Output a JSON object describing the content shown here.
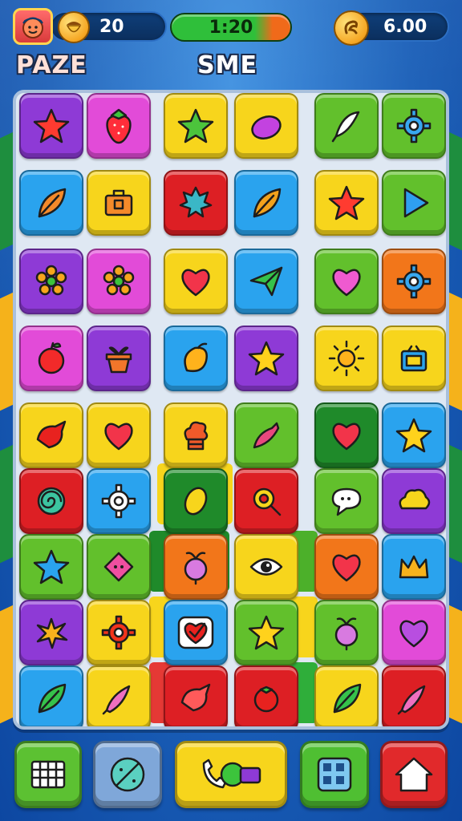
{
  "hud": {
    "moves": "20",
    "timer": "1:20",
    "score": "6.00"
  },
  "titles": {
    "left": "PAZE",
    "right": "SME"
  },
  "colors": {
    "purple": "#8e3ad6",
    "magenta": "#e24bd8",
    "yellow": "#f7d51c",
    "green": "#62c02c",
    "blue": "#2aa3ee",
    "red": "#dd1f24",
    "orange": "#f2761a",
    "dark_green": "#1f8a2a"
  },
  "board": {
    "rows": [
      [
        [
          "purple",
          "star"
        ],
        [
          "magenta",
          "strawberry"
        ],
        [
          "yellow",
          "star"
        ],
        [
          "yellow",
          "eggplant"
        ],
        [
          "green",
          "feather"
        ],
        [
          "green",
          "gear"
        ]
      ],
      [
        [
          "blue",
          "leaf"
        ],
        [
          "yellow",
          "suitcase"
        ],
        [
          "red",
          "maple-leaf"
        ],
        [
          "blue",
          "leaf"
        ],
        [
          "yellow",
          "star"
        ],
        [
          "green",
          "play-triangle"
        ]
      ],
      [
        [
          "purple",
          "flower"
        ],
        [
          "magenta",
          "flower"
        ],
        [
          "yellow",
          "heart"
        ],
        [
          "blue",
          "paper-plane"
        ],
        [
          "green",
          "heart"
        ],
        [
          "orange",
          "gear"
        ]
      ],
      [
        [
          "magenta",
          "apple"
        ],
        [
          "purple",
          "flower-pot"
        ],
        [
          "blue",
          "mango"
        ],
        [
          "purple",
          "star"
        ],
        [
          "yellow",
          "sun"
        ],
        [
          "yellow",
          "tv"
        ]
      ],
      [
        [
          "yellow",
          "bird"
        ],
        [
          "yellow",
          "heart"
        ],
        [
          "yellow",
          "chef-hat"
        ],
        [
          "green",
          "chili"
        ],
        [
          "dkgreen",
          "heart"
        ],
        [
          "blue",
          "star"
        ]
      ],
      [
        [
          "red",
          "spiral"
        ],
        [
          "blue",
          "gear"
        ],
        [
          "dkgreen",
          "lemon"
        ],
        [
          "red",
          "magnifier"
        ],
        [
          "green",
          "speech-bubble"
        ],
        [
          "purple",
          "cloud"
        ]
      ],
      [
        [
          "green",
          "star"
        ],
        [
          "green",
          "diamond"
        ],
        [
          "orange",
          "turnip"
        ],
        [
          "yellow",
          "eye"
        ],
        [
          "orange",
          "heart"
        ],
        [
          "blue",
          "crown"
        ]
      ],
      [
        [
          "purple",
          "splash"
        ],
        [
          "yellow",
          "gear"
        ],
        [
          "blue",
          "heart-check"
        ],
        [
          "green",
          "star"
        ],
        [
          "green",
          "turnip"
        ],
        [
          "magenta",
          "heart"
        ]
      ],
      [
        [
          "blue",
          "leaf"
        ],
        [
          "yellow",
          "rocket"
        ],
        [
          "red",
          "bird"
        ],
        [
          "red",
          "tomato"
        ],
        [
          "yellow",
          "leaf"
        ],
        [
          "red",
          "rocket"
        ]
      ]
    ]
  },
  "bottom_bar": [
    {
      "name": "grid-button",
      "color": "#5cc132",
      "icon": "grid-icon"
    },
    {
      "name": "magic-button",
      "color": "#7fa7d9",
      "icon": "wand-icon"
    },
    {
      "name": "powerup-button",
      "color": "#f7d51c",
      "icon": "phone-icon"
    },
    {
      "name": "apps-button",
      "color": "#4fbf32",
      "icon": "apps-icon"
    },
    {
      "name": "home-button",
      "color": "#e1292b",
      "icon": "home-icon"
    }
  ]
}
